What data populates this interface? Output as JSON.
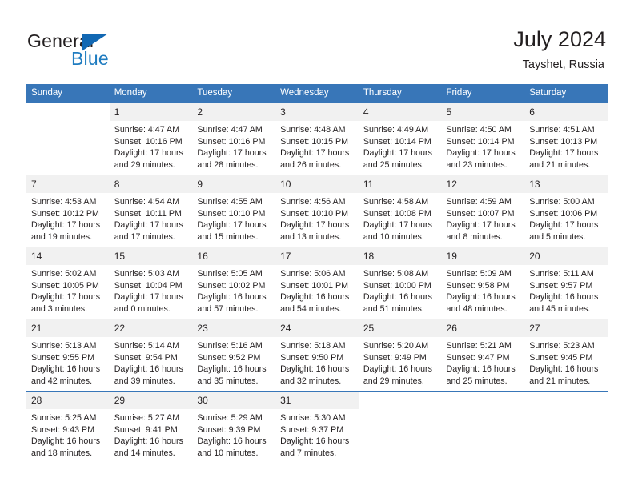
{
  "brand": {
    "name_part1": "General",
    "name_part2": "Blue",
    "triangle_color": "#1268b3",
    "blue_color": "#1f7cc0"
  },
  "header": {
    "title": "July 2024",
    "subtitle": "Tayshet, Russia"
  },
  "theme": {
    "header_row_bg": "#3876b8",
    "daynum_bg": "#f1f1f1",
    "text_color": "#231f20",
    "page_bg": "#ffffff"
  },
  "weekday_headers": [
    "Sunday",
    "Monday",
    "Tuesday",
    "Wednesday",
    "Thursday",
    "Friday",
    "Saturday"
  ],
  "weeks": [
    [
      {
        "day": "",
        "blank": true,
        "sunrise": "",
        "sunset": "",
        "daylight1": "",
        "daylight2": ""
      },
      {
        "day": "1",
        "sunrise": "Sunrise: 4:47 AM",
        "sunset": "Sunset: 10:16 PM",
        "daylight1": "Daylight: 17 hours",
        "daylight2": "and 29 minutes."
      },
      {
        "day": "2",
        "sunrise": "Sunrise: 4:47 AM",
        "sunset": "Sunset: 10:16 PM",
        "daylight1": "Daylight: 17 hours",
        "daylight2": "and 28 minutes."
      },
      {
        "day": "3",
        "sunrise": "Sunrise: 4:48 AM",
        "sunset": "Sunset: 10:15 PM",
        "daylight1": "Daylight: 17 hours",
        "daylight2": "and 26 minutes."
      },
      {
        "day": "4",
        "sunrise": "Sunrise: 4:49 AM",
        "sunset": "Sunset: 10:14 PM",
        "daylight1": "Daylight: 17 hours",
        "daylight2": "and 25 minutes."
      },
      {
        "day": "5",
        "sunrise": "Sunrise: 4:50 AM",
        "sunset": "Sunset: 10:14 PM",
        "daylight1": "Daylight: 17 hours",
        "daylight2": "and 23 minutes."
      },
      {
        "day": "6",
        "sunrise": "Sunrise: 4:51 AM",
        "sunset": "Sunset: 10:13 PM",
        "daylight1": "Daylight: 17 hours",
        "daylight2": "and 21 minutes."
      }
    ],
    [
      {
        "day": "7",
        "sunrise": "Sunrise: 4:53 AM",
        "sunset": "Sunset: 10:12 PM",
        "daylight1": "Daylight: 17 hours",
        "daylight2": "and 19 minutes."
      },
      {
        "day": "8",
        "sunrise": "Sunrise: 4:54 AM",
        "sunset": "Sunset: 10:11 PM",
        "daylight1": "Daylight: 17 hours",
        "daylight2": "and 17 minutes."
      },
      {
        "day": "9",
        "sunrise": "Sunrise: 4:55 AM",
        "sunset": "Sunset: 10:10 PM",
        "daylight1": "Daylight: 17 hours",
        "daylight2": "and 15 minutes."
      },
      {
        "day": "10",
        "sunrise": "Sunrise: 4:56 AM",
        "sunset": "Sunset: 10:10 PM",
        "daylight1": "Daylight: 17 hours",
        "daylight2": "and 13 minutes."
      },
      {
        "day": "11",
        "sunrise": "Sunrise: 4:58 AM",
        "sunset": "Sunset: 10:08 PM",
        "daylight1": "Daylight: 17 hours",
        "daylight2": "and 10 minutes."
      },
      {
        "day": "12",
        "sunrise": "Sunrise: 4:59 AM",
        "sunset": "Sunset: 10:07 PM",
        "daylight1": "Daylight: 17 hours",
        "daylight2": "and 8 minutes."
      },
      {
        "day": "13",
        "sunrise": "Sunrise: 5:00 AM",
        "sunset": "Sunset: 10:06 PM",
        "daylight1": "Daylight: 17 hours",
        "daylight2": "and 5 minutes."
      }
    ],
    [
      {
        "day": "14",
        "sunrise": "Sunrise: 5:02 AM",
        "sunset": "Sunset: 10:05 PM",
        "daylight1": "Daylight: 17 hours",
        "daylight2": "and 3 minutes."
      },
      {
        "day": "15",
        "sunrise": "Sunrise: 5:03 AM",
        "sunset": "Sunset: 10:04 PM",
        "daylight1": "Daylight: 17 hours",
        "daylight2": "and 0 minutes."
      },
      {
        "day": "16",
        "sunrise": "Sunrise: 5:05 AM",
        "sunset": "Sunset: 10:02 PM",
        "daylight1": "Daylight: 16 hours",
        "daylight2": "and 57 minutes."
      },
      {
        "day": "17",
        "sunrise": "Sunrise: 5:06 AM",
        "sunset": "Sunset: 10:01 PM",
        "daylight1": "Daylight: 16 hours",
        "daylight2": "and 54 minutes."
      },
      {
        "day": "18",
        "sunrise": "Sunrise: 5:08 AM",
        "sunset": "Sunset: 10:00 PM",
        "daylight1": "Daylight: 16 hours",
        "daylight2": "and 51 minutes."
      },
      {
        "day": "19",
        "sunrise": "Sunrise: 5:09 AM",
        "sunset": "Sunset: 9:58 PM",
        "daylight1": "Daylight: 16 hours",
        "daylight2": "and 48 minutes."
      },
      {
        "day": "20",
        "sunrise": "Sunrise: 5:11 AM",
        "sunset": "Sunset: 9:57 PM",
        "daylight1": "Daylight: 16 hours",
        "daylight2": "and 45 minutes."
      }
    ],
    [
      {
        "day": "21",
        "sunrise": "Sunrise: 5:13 AM",
        "sunset": "Sunset: 9:55 PM",
        "daylight1": "Daylight: 16 hours",
        "daylight2": "and 42 minutes."
      },
      {
        "day": "22",
        "sunrise": "Sunrise: 5:14 AM",
        "sunset": "Sunset: 9:54 PM",
        "daylight1": "Daylight: 16 hours",
        "daylight2": "and 39 minutes."
      },
      {
        "day": "23",
        "sunrise": "Sunrise: 5:16 AM",
        "sunset": "Sunset: 9:52 PM",
        "daylight1": "Daylight: 16 hours",
        "daylight2": "and 35 minutes."
      },
      {
        "day": "24",
        "sunrise": "Sunrise: 5:18 AM",
        "sunset": "Sunset: 9:50 PM",
        "daylight1": "Daylight: 16 hours",
        "daylight2": "and 32 minutes."
      },
      {
        "day": "25",
        "sunrise": "Sunrise: 5:20 AM",
        "sunset": "Sunset: 9:49 PM",
        "daylight1": "Daylight: 16 hours",
        "daylight2": "and 29 minutes."
      },
      {
        "day": "26",
        "sunrise": "Sunrise: 5:21 AM",
        "sunset": "Sunset: 9:47 PM",
        "daylight1": "Daylight: 16 hours",
        "daylight2": "and 25 minutes."
      },
      {
        "day": "27",
        "sunrise": "Sunrise: 5:23 AM",
        "sunset": "Sunset: 9:45 PM",
        "daylight1": "Daylight: 16 hours",
        "daylight2": "and 21 minutes."
      }
    ],
    [
      {
        "day": "28",
        "sunrise": "Sunrise: 5:25 AM",
        "sunset": "Sunset: 9:43 PM",
        "daylight1": "Daylight: 16 hours",
        "daylight2": "and 18 minutes."
      },
      {
        "day": "29",
        "sunrise": "Sunrise: 5:27 AM",
        "sunset": "Sunset: 9:41 PM",
        "daylight1": "Daylight: 16 hours",
        "daylight2": "and 14 minutes."
      },
      {
        "day": "30",
        "sunrise": "Sunrise: 5:29 AM",
        "sunset": "Sunset: 9:39 PM",
        "daylight1": "Daylight: 16 hours",
        "daylight2": "and 10 minutes."
      },
      {
        "day": "31",
        "sunrise": "Sunrise: 5:30 AM",
        "sunset": "Sunset: 9:37 PM",
        "daylight1": "Daylight: 16 hours",
        "daylight2": "and 7 minutes."
      },
      {
        "day": "",
        "blank": true,
        "sunrise": "",
        "sunset": "",
        "daylight1": "",
        "daylight2": ""
      },
      {
        "day": "",
        "blank": true,
        "sunrise": "",
        "sunset": "",
        "daylight1": "",
        "daylight2": ""
      },
      {
        "day": "",
        "blank": true,
        "sunrise": "",
        "sunset": "",
        "daylight1": "",
        "daylight2": ""
      }
    ]
  ]
}
